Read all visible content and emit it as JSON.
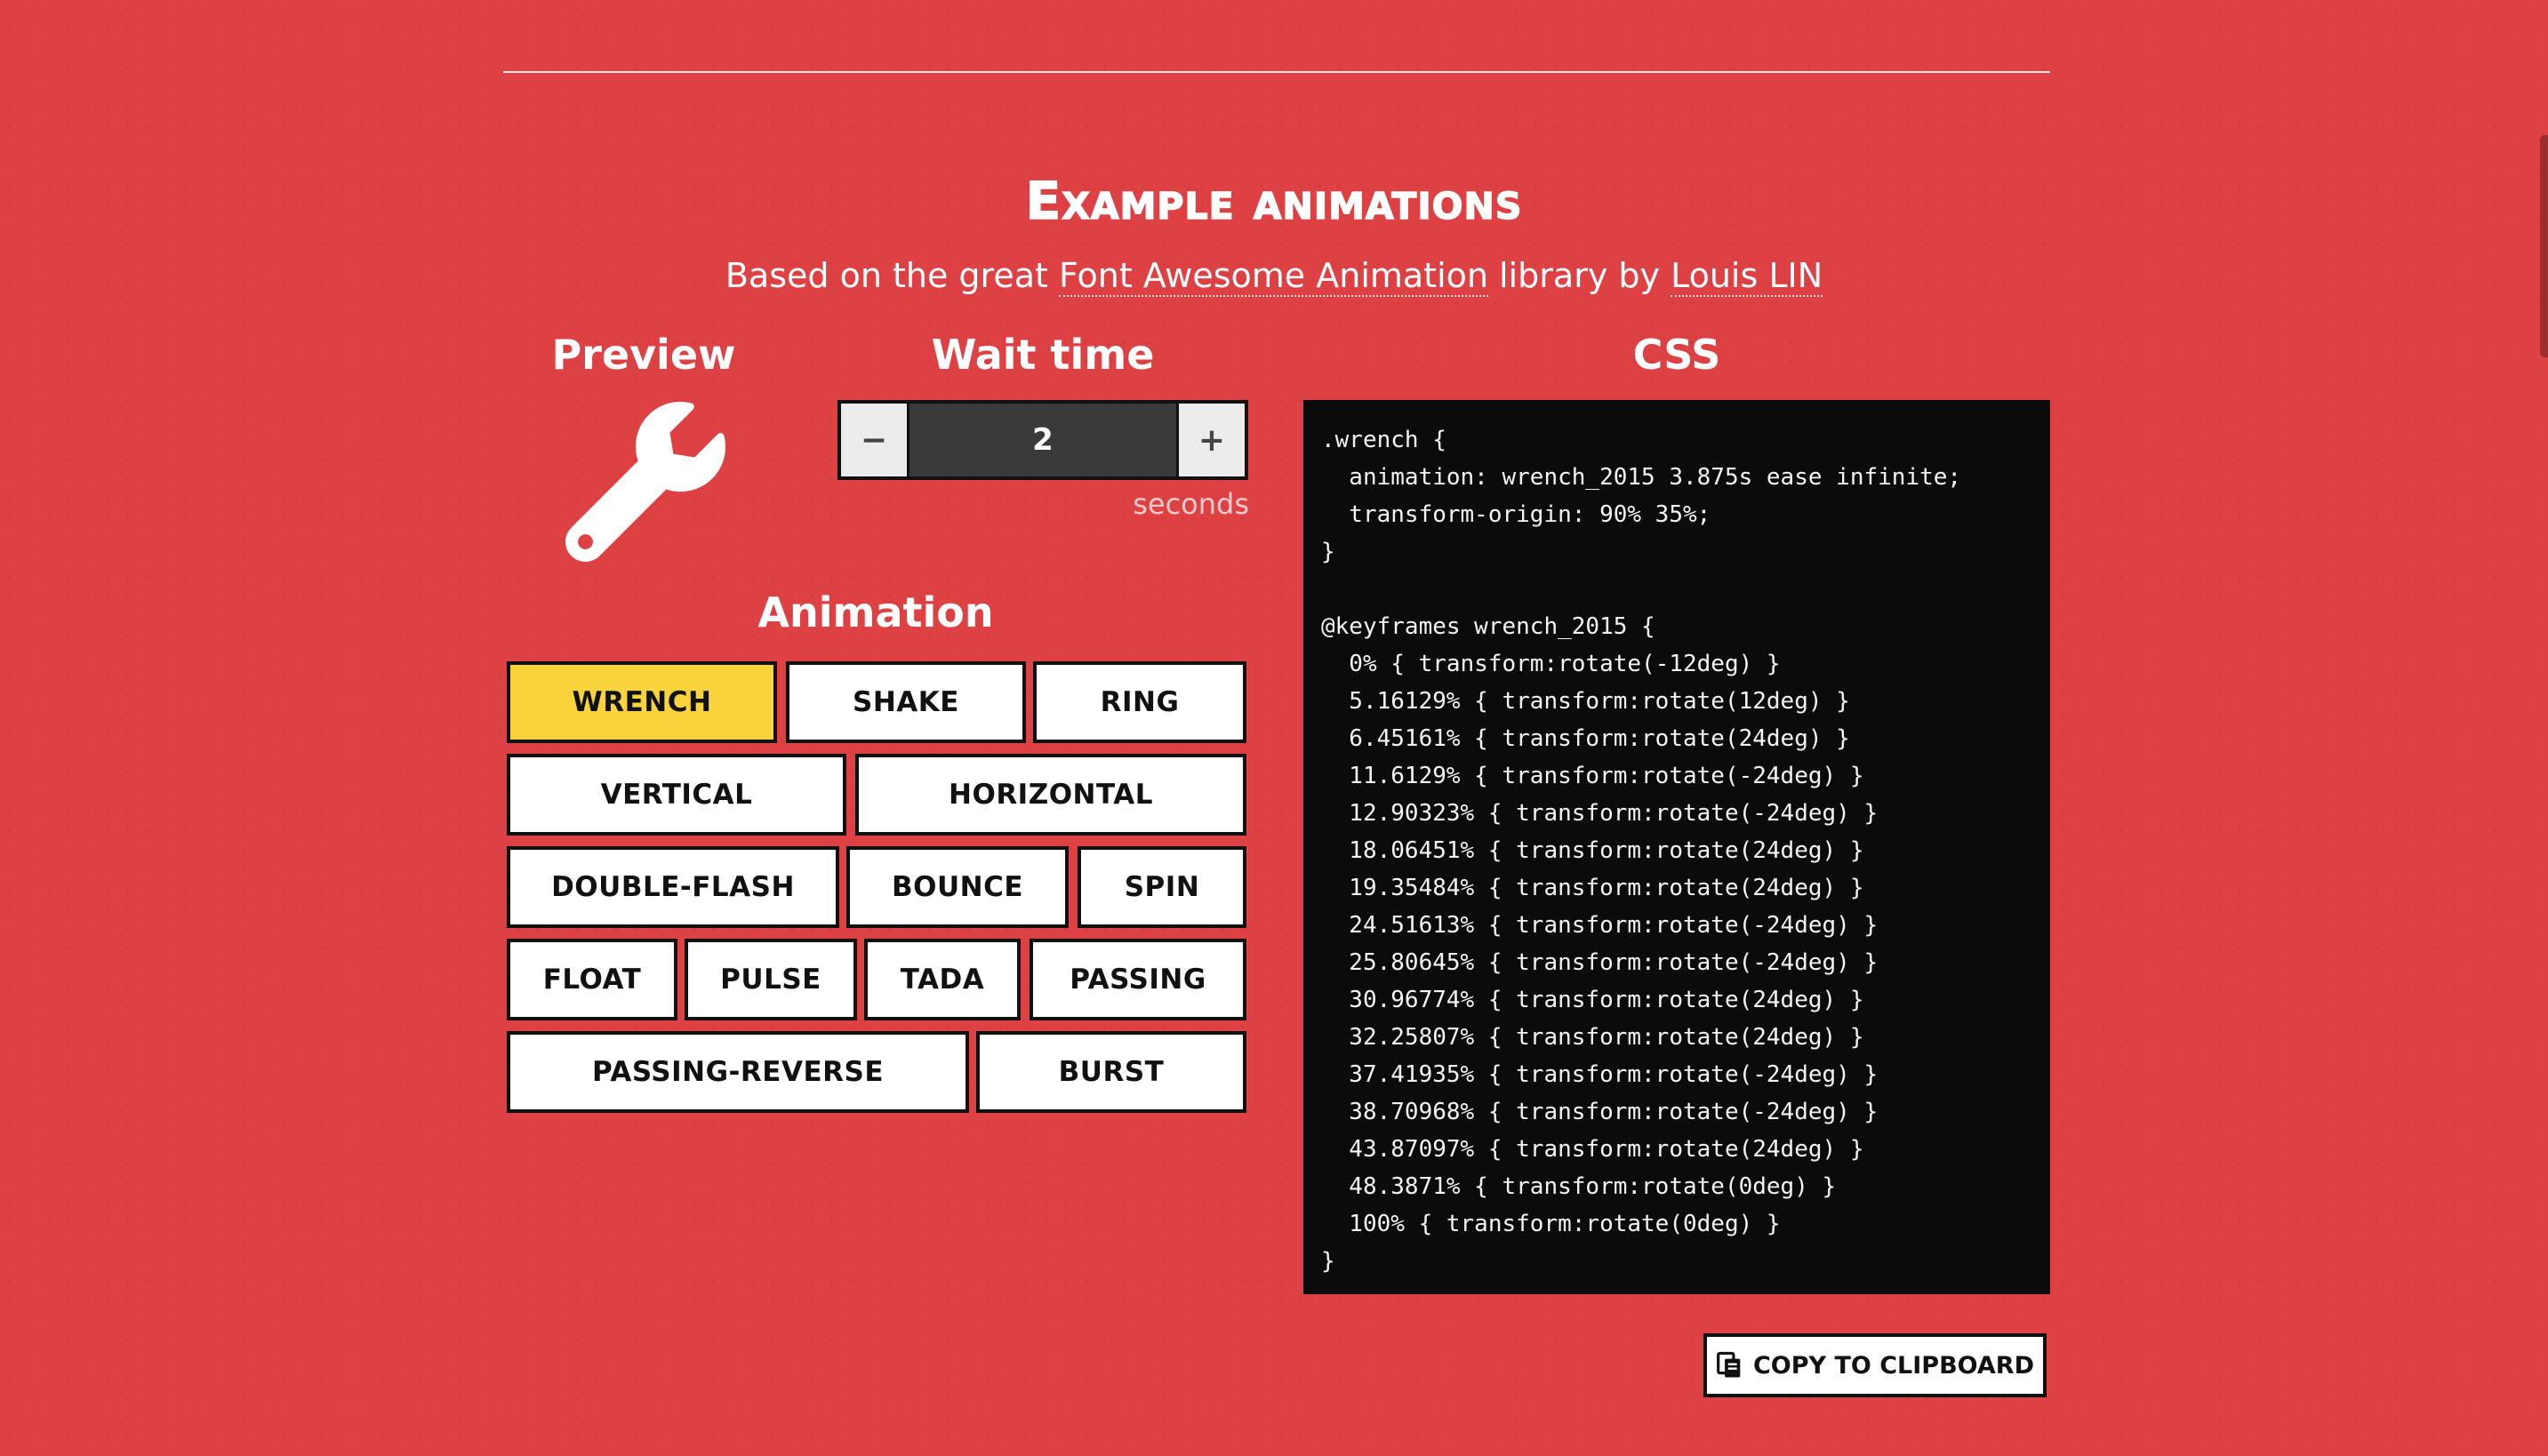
{
  "section": {
    "title": "Example animations",
    "subtitle_prefix": "Based on the great ",
    "subtitle_link1": "Font Awesome Animation",
    "subtitle_mid": " library by ",
    "subtitle_link2": "Louis LIN"
  },
  "preview": {
    "heading": "Preview",
    "icon": "wrench-icon",
    "icon_color": "#ffffff"
  },
  "wait": {
    "heading": "Wait time",
    "decrement": "−",
    "increment": "+",
    "value": "2",
    "units": "seconds"
  },
  "animation": {
    "heading": "Animation",
    "active": "WRENCH",
    "active_color": "#f9d33c",
    "buttons": [
      "WRENCH",
      "SHAKE",
      "RING",
      "VERTICAL",
      "HORIZONTAL",
      "DOUBLE-FLASH",
      "BOUNCE",
      "SPIN",
      "FLOAT",
      "PULSE",
      "TADA",
      "PASSING",
      "PASSING-REVERSE",
      "BURST"
    ]
  },
  "css": {
    "heading": "CSS",
    "lines": [
      ".wrench {",
      "  animation: wrench_2015 3.875s ease infinite;",
      "  transform-origin: 90% 35%;",
      "}",
      "",
      "@keyframes wrench_2015 {",
      "  0% { transform:rotate(-12deg) }",
      "  5.16129% { transform:rotate(12deg) }",
      "  6.45161% { transform:rotate(24deg) }",
      "  11.6129% { transform:rotate(-24deg) }",
      "  12.90323% { transform:rotate(-24deg) }",
      "  18.06451% { transform:rotate(24deg) }",
      "  19.35484% { transform:rotate(24deg) }",
      "  24.51613% { transform:rotate(-24deg) }",
      "  25.80645% { transform:rotate(-24deg) }",
      "  30.96774% { transform:rotate(24deg) }",
      "  32.25807% { transform:rotate(24deg) }",
      "  37.41935% { transform:rotate(-24deg) }",
      "  38.70968% { transform:rotate(-24deg) }",
      "  43.87097% { transform:rotate(24deg) }",
      "  48.3871% { transform:rotate(0deg) }",
      "  100% { transform:rotate(0deg) }",
      "}"
    ]
  },
  "copy": {
    "label": "COPY TO CLIPBOARD",
    "icon": "clipboard-icon"
  },
  "colors": {
    "background": "#dd4143",
    "code_background": "#0b0b0b",
    "button_border": "#111111"
  }
}
